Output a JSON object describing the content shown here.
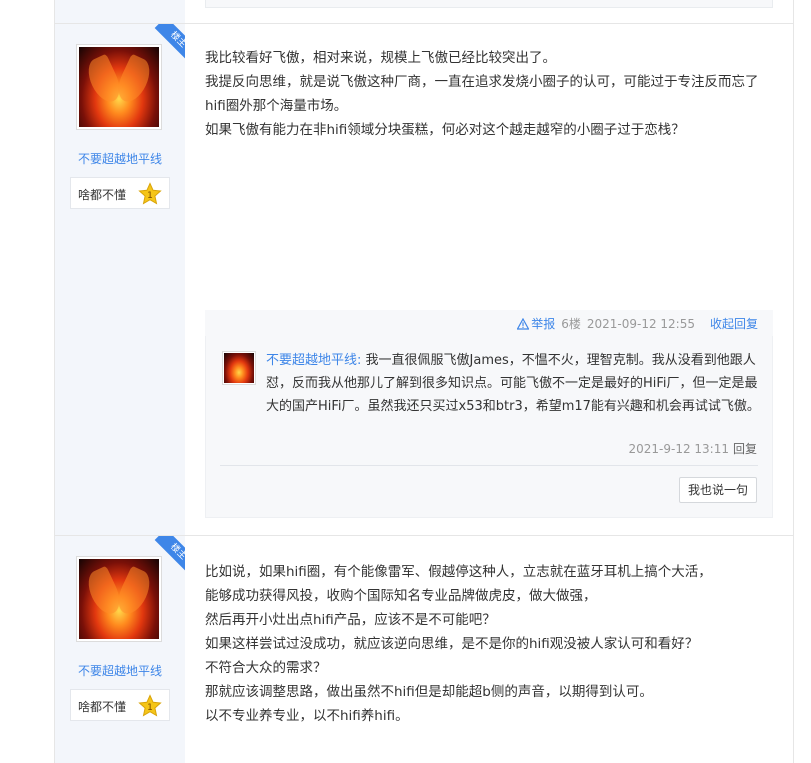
{
  "posts": [
    {
      "badge": "楼主",
      "author": {
        "name": "不要超越地平线",
        "level_text": "啥都不懂",
        "level_num": "1"
      },
      "lines": [
        "我比较看好飞傲，相对来说，规模上飞傲已经比较突出了。",
        "我提反向思维，就是说飞傲这种厂商，一直在追求发烧小圈子的认可，可能过于专注反而忘了hifi圈外那个海量市场。",
        "如果飞傲有能力在非hifi领域分块蛋糕，何必对这个越走越窄的小圈子过于恋栈？"
      ],
      "meta": {
        "report": "举报",
        "floor": "6楼",
        "time": "2021-09-12 12:55",
        "collapse": "收起回复"
      },
      "reply": {
        "user": "不要超越地平线:",
        "text": " 我一直很佩服飞傲James，不愠不火，理智克制。我从没看到他跟人怼，反而我从他那儿了解到很多知识点。可能飞傲不一定是最好的HiFi厂，但一定是最大的国产HiFi厂。虽然我还只买过x53和btr3，希望m17能有兴趣和机会再试试飞傲。",
        "time": "2021-9-12 13:11",
        "reply_label": "回复"
      },
      "say_button": "我也说一句"
    },
    {
      "badge": "楼主",
      "author": {
        "name": "不要超越地平线",
        "level_text": "啥都不懂",
        "level_num": "1"
      },
      "lines": [
        "比如说，如果hifi圈，有个能像雷军、假越停这种人，立志就在蓝牙耳机上搞个大活，",
        "能够成功获得风投，收购个国际知名专业品牌做虎皮，做大做强，",
        "然后再开小灶出点hifi产品，应该不是不可能吧？",
        "如果这样尝试过没成功，就应该逆向思维，是不是你的hifi观没被人家认可和看好？",
        "不符合大众的需求？",
        "那就应该调整思路，做出虽然不hifi但是却能超b侧的声音，以期得到认可。",
        "以不专业养专业，以不hifi养hifi。"
      ]
    }
  ],
  "colors": {
    "accent": "#3e86e8",
    "sidebar_bg": "#f3f6fb",
    "star": "#f5c518"
  },
  "icons": {
    "warning": "warning-icon",
    "star": "star-icon"
  }
}
